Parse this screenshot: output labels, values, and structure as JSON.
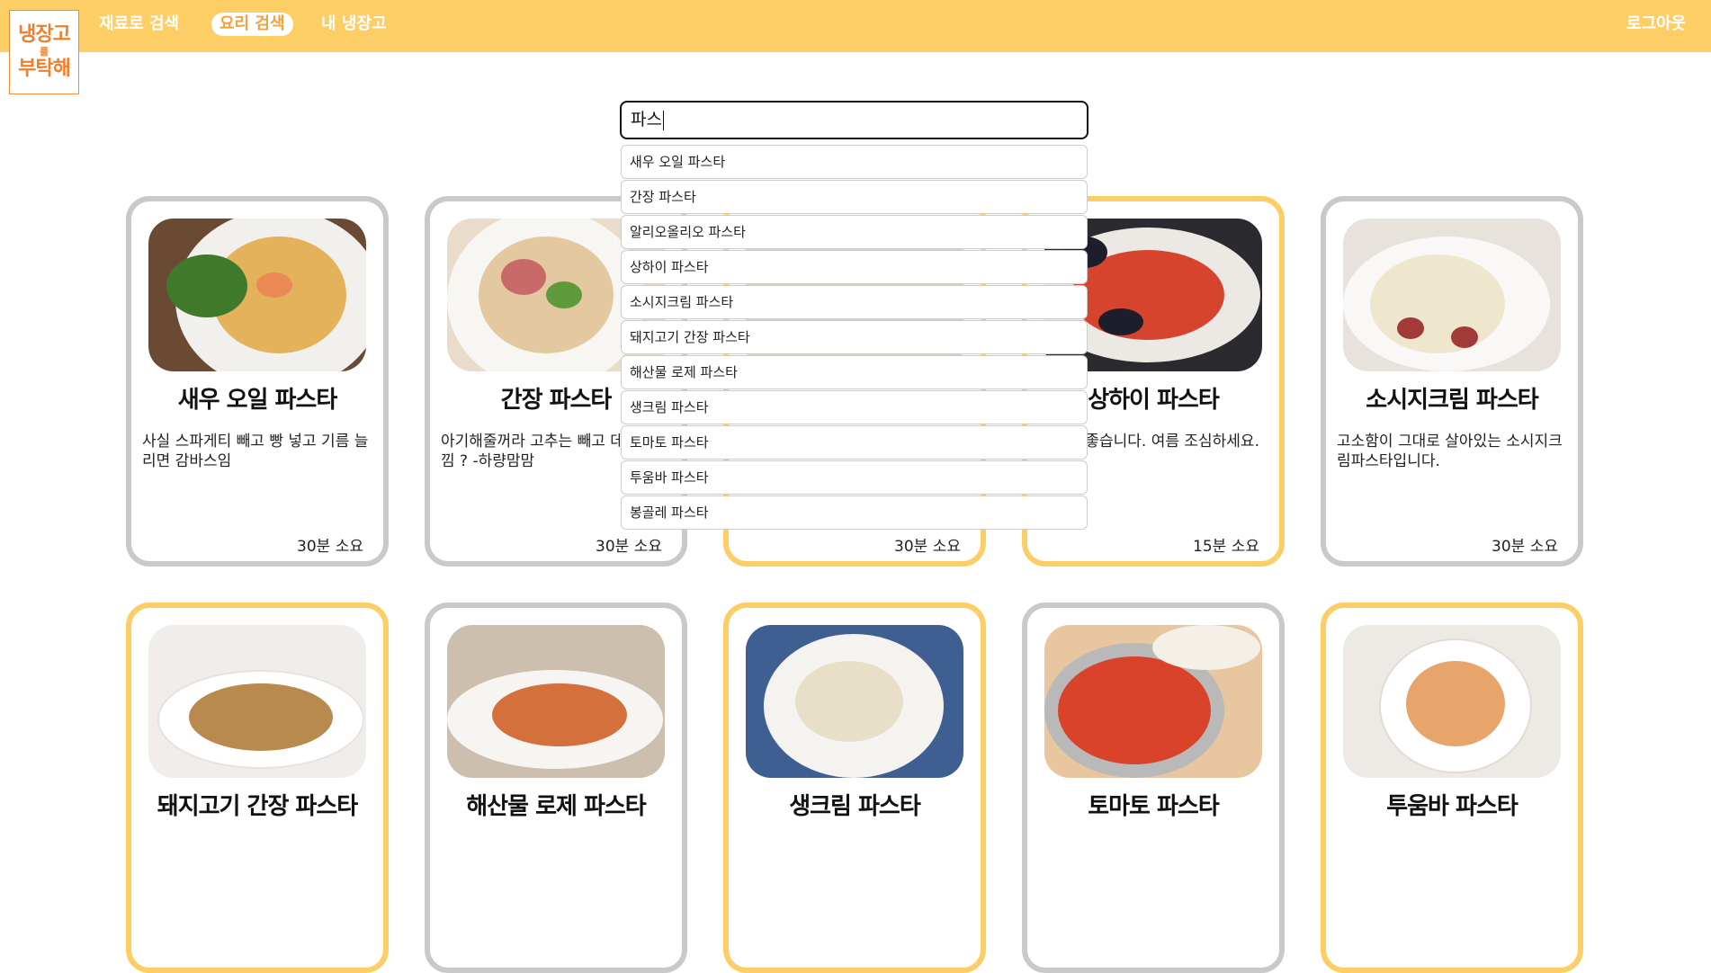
{
  "header": {
    "logo": {
      "line1": "냉장고",
      "line2": "를",
      "line3": "부탁해"
    },
    "nav": [
      {
        "label": "재료로 검색"
      },
      {
        "label": "요리 검색"
      },
      {
        "label": "내 냉장고"
      }
    ],
    "logout": "로그아웃",
    "colors": {
      "bar": "#FDCD66",
      "logo_accent": "#EF7F2D"
    }
  },
  "search": {
    "value": "파스",
    "suggestions": [
      "새우 오일 파스타",
      "간장 파스타",
      "알리오올리오 파스타",
      "상하이 파스타",
      "소시지크림 파스타",
      "돼지고기 간장 파스타",
      "해산물 로제 파스타",
      "생크림 파스타",
      "토마토 파스타",
      "투움바 파스타",
      "봉골레 파스타"
    ]
  },
  "recipes": [
    {
      "title": "새우 오일 파스타",
      "desc": "사실 스파게티 빼고 빵 넣고 기름 늘리면 감바스임",
      "time": "30분 소요",
      "highlight": false
    },
    {
      "title": "간장 파스타",
      "desc": "아기해줄꺼라 고추는 빼고 데 잡채느낌 ? -하량맘맘",
      "time": "30분 소요",
      "highlight": false
    },
    {
      "title": "",
      "desc": "",
      "time": "30분 소요",
      "highlight": true
    },
    {
      "title": "상하이 파스타",
      "desc": "홍합이 좋습니다. 여름 조심하세요.",
      "time": "15분 소요",
      "highlight": true
    },
    {
      "title": "소시지크림 파스타",
      "desc": "고소함이 그대로 살아있는 소시지크림파스타입니다.",
      "time": "30분 소요",
      "highlight": false
    },
    {
      "title": "돼지고기 간장 파스타",
      "desc": "",
      "time": "",
      "highlight": true
    },
    {
      "title": "해산물 로제 파스타",
      "desc": "",
      "time": "",
      "highlight": false
    },
    {
      "title": "생크림 파스타",
      "desc": "",
      "time": "",
      "highlight": true
    },
    {
      "title": "토마토 파스타",
      "desc": "",
      "time": "",
      "highlight": false
    },
    {
      "title": "투움바 파스타",
      "desc": "",
      "time": "",
      "highlight": true
    }
  ]
}
